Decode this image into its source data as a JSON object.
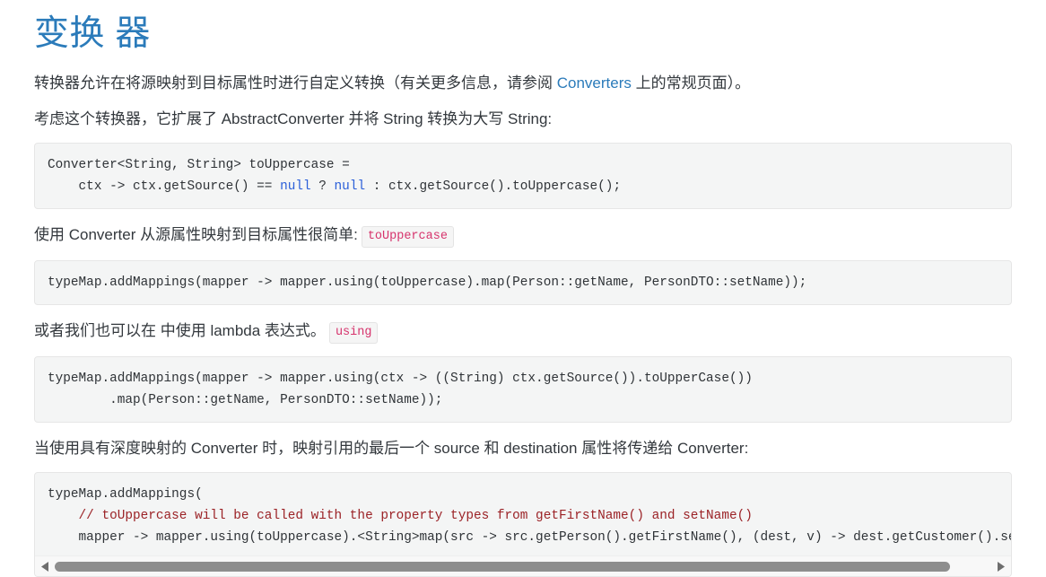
{
  "header": {
    "title": "变换 器"
  },
  "paragraphs": {
    "intro_before_link": "转换器允许在将源映射到目标属性时进行自定义转换（有关更多信息，请参阅 ",
    "intro_link": "Converters",
    "intro_after_link": " 上的常规页面）。",
    "consider": "考虑这个转换器，它扩展了 AbstractConverter 并将 String 转换为大写 String:",
    "using_converter": "使用 Converter 从源属性映射到目标属性很简单:",
    "using_converter_code": "toUppercase",
    "lambda": "或者我们也可以在 中使用 lambda 表达式。",
    "lambda_code": "using",
    "deep_mapping": "当使用具有深度映射的 Converter 时，映射引用的最后一个 source 和 destination 属性将传递给 Converter:"
  },
  "code_blocks": {
    "converter_declaration": {
      "line1": "Converter<String, String> toUppercase =",
      "line2_pre": "    ctx -> ctx.getSource() == ",
      "line2_kw1": "null",
      "line2_mid": " ? ",
      "line2_kw2": "null",
      "line2_post": " : ctx.getSource().toUppercase();"
    },
    "add_mappings_simple": {
      "line1": "typeMap.addMappings(mapper -> mapper.using(toUppercase).map(Person::getName, PersonDTO::setName));"
    },
    "add_mappings_lambda": {
      "line1": "typeMap.addMappings(mapper -> mapper.using(ctx -> ((String) ctx.getSource()).toUpperCase())",
      "line2": "        .map(Person::getName, PersonDTO::setName));"
    },
    "add_mappings_deep": {
      "line1": "typeMap.addMappings(",
      "line2_comment": "    // toUppercase will be called with the property types from getFirstName() and setName()",
      "line3": "    mapper -> mapper.using(toUppercase).<String>map(src -> src.getPerson().getFirstName(), (dest, v) -> dest.getCustomer().setName"
    }
  },
  "scrollbar": {
    "left_arrow_icon": "triangle-left-icon",
    "right_arrow_icon": "triangle-right-icon",
    "thumb_position_percent": 0
  },
  "colors": {
    "heading": "#2b7bba",
    "link": "#2b7bba",
    "inline_code_text": "#d6336c",
    "code_bg": "#f4f5f5",
    "keyword": "#2b5fd9",
    "comment": "#9b2226",
    "scrollbar_thumb": "#8e8e8e"
  }
}
